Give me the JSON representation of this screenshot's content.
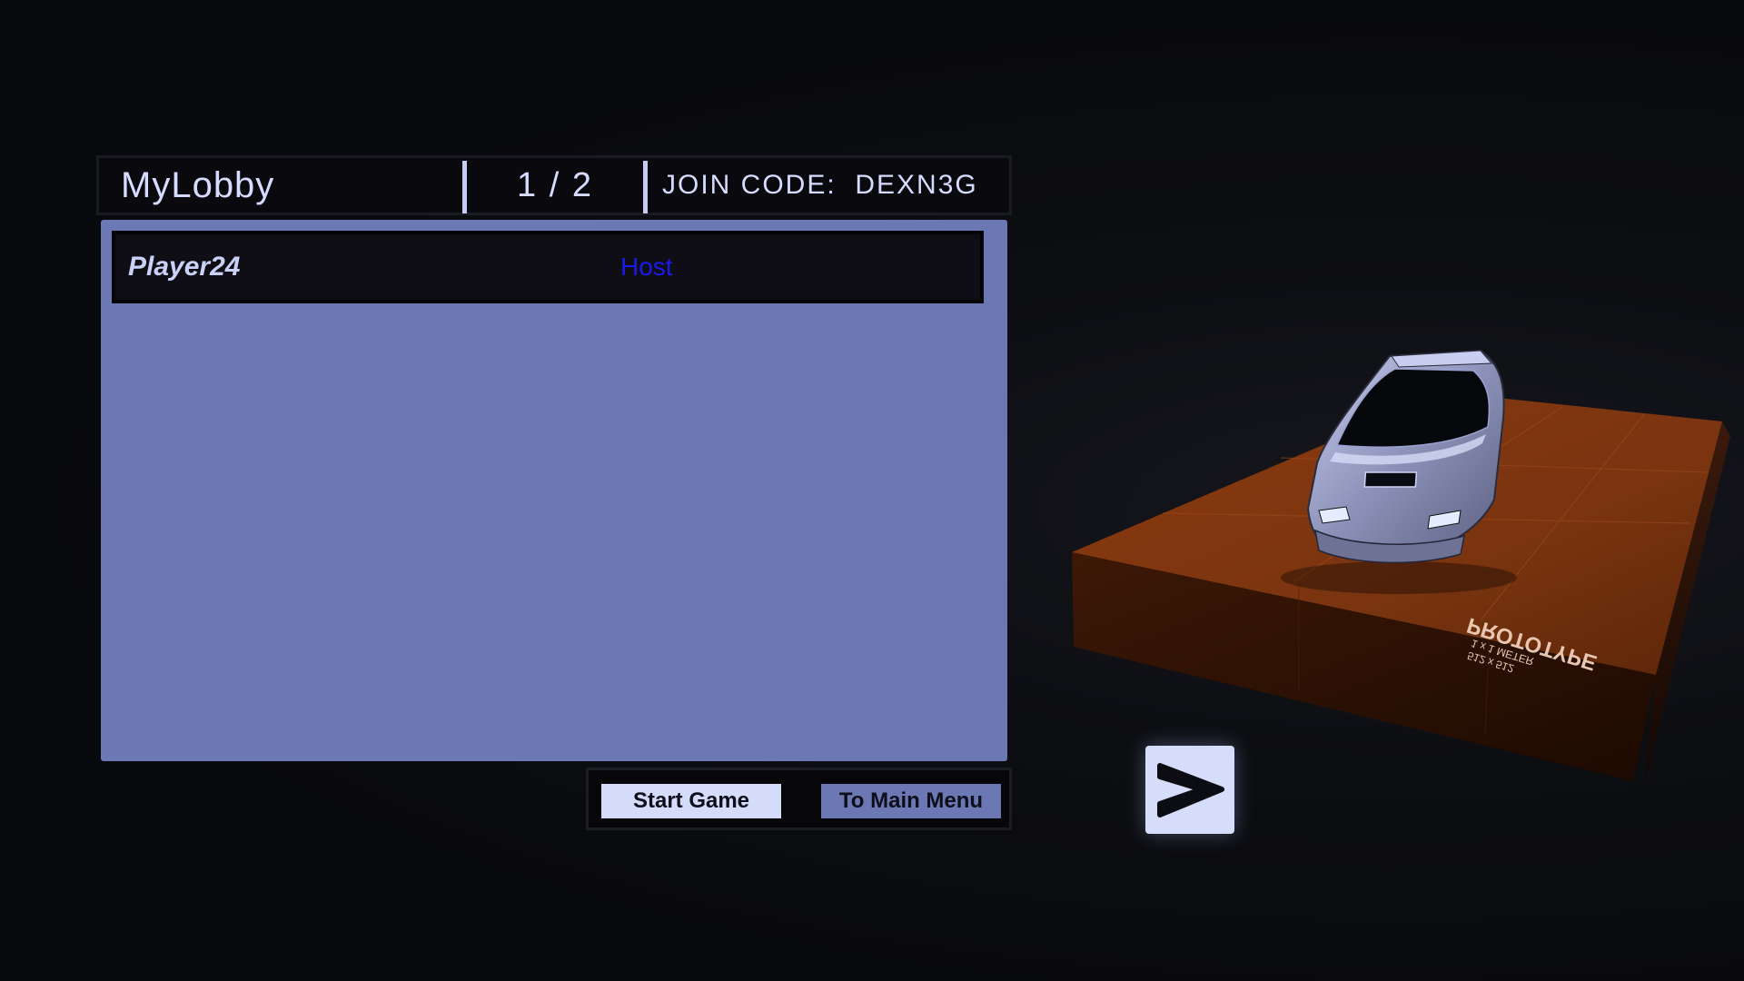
{
  "lobby": {
    "name": "MyLobby",
    "player_count": "1 / 2",
    "join_code_label": "JOIN CODE:  DEXN3G"
  },
  "players": [
    {
      "name": "Player24",
      "role": "Host"
    }
  ],
  "buttons": {
    "start_game": "Start Game",
    "main_menu": "To Main Menu"
  },
  "next_button": {
    "icon": "chevron-right-icon"
  },
  "preview": {
    "platform_label": "PROTOTYPE",
    "platform_sublabel_1": "1 x 1 METER",
    "platform_sublabel_2": "512 x 512"
  },
  "colors": {
    "background": "#0b0c10",
    "panel": "#6c78b4",
    "text_light": "#d6dcff",
    "host_role": "#1a1aee",
    "platform": "#8a3a0e"
  }
}
